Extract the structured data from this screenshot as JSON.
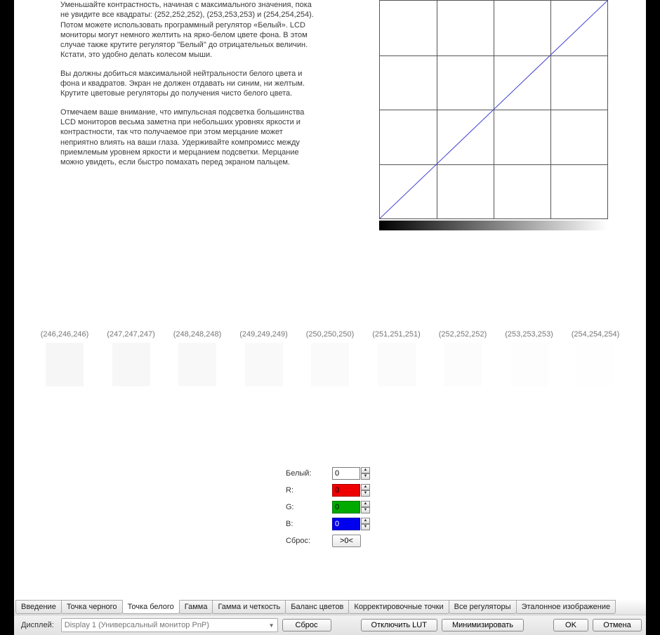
{
  "instructions": {
    "para1": "Уменьшайте контрастность, начиная с максимального значения, пока не увидите все квадраты: (252,252,252), (253,253,253) и (254,254,254). Потом можете использовать программный регулятор «Белый». LCD мониторы могут немного желтить на ярко-белом цвете фона. В этом случае также крутите регулятор \"Белый\" до отрицательных величин. Кстати, это удобно делать колесом мыши.",
    "para2": "Вы должны добиться максимальной нейтральности белого цвета и фона и квадратов. Экран не должен отдавать ни синим, ни желтым. Крутите цветовые регуляторы до получения чисто белого цвета.",
    "para3": "Отмечаем ваше внимание, что импульсная подсветка большинства LCD мониторов весьма заметна при небольших уровнях яркости и контрастности, так что получаемое при этом мерцание может неприятно влиять на ваши глаза. Удерживайте компромисс между приемлемым уровнем яркости и мерцанием подсветки. Мерцание можно увидеть, если быстро помахать перед экраном пальцем."
  },
  "swatches": [
    {
      "label": "(246,246,246)",
      "color": "#f6f6f6"
    },
    {
      "label": "(247,247,247)",
      "color": "#f7f7f7"
    },
    {
      "label": "(248,248,248)",
      "color": "#f8f8f8"
    },
    {
      "label": "(249,249,249)",
      "color": "#f9f9f9"
    },
    {
      "label": "(250,250,250)",
      "color": "#fafafa"
    },
    {
      "label": "(251,251,251)",
      "color": "#fbfbfb"
    },
    {
      "label": "(252,252,252)",
      "color": "#fcfcfc"
    },
    {
      "label": "(253,253,253)",
      "color": "#fdfdfd"
    },
    {
      "label": "(254,254,254)",
      "color": "#fefefe"
    }
  ],
  "controls": {
    "white_label": "Белый:",
    "white_value": "0",
    "r_label": "R:",
    "r_value": "0",
    "g_label": "G:",
    "g_value": "0",
    "b_label": "B:",
    "b_value": "0",
    "reset_label": "Сброс:",
    "reset_button": ">0<"
  },
  "tabs": [
    "Введение",
    "Точка черного",
    "Точка белого",
    "Гамма",
    "Гамма и четкость",
    "Баланс цветов",
    "Корректировочные точки",
    "Все регуляторы",
    "Эталонное изображение"
  ],
  "active_tab_index": 2,
  "bottom": {
    "display_label": "Дисплей:",
    "display_value": "Display 1 (Универсальный монитор PnP)",
    "reset_btn": "Сброс",
    "disable_lut_btn": "Отключить LUT",
    "minimize_btn": "Минимизировать",
    "ok_btn": "OK",
    "cancel_btn": "Отмена"
  },
  "chart_data": {
    "type": "line",
    "title": "",
    "xlabel": "",
    "ylabel": "",
    "x": [
      0,
      64,
      128,
      192,
      255
    ],
    "y": [
      0,
      64,
      128,
      192,
      255
    ],
    "xlim": [
      0,
      255
    ],
    "ylim": [
      0,
      255
    ],
    "grid_columns": 4,
    "grid_rows": 4,
    "note": "Identity tone curve (output = input); 4×4 grid; bottom gradient 0→255"
  }
}
